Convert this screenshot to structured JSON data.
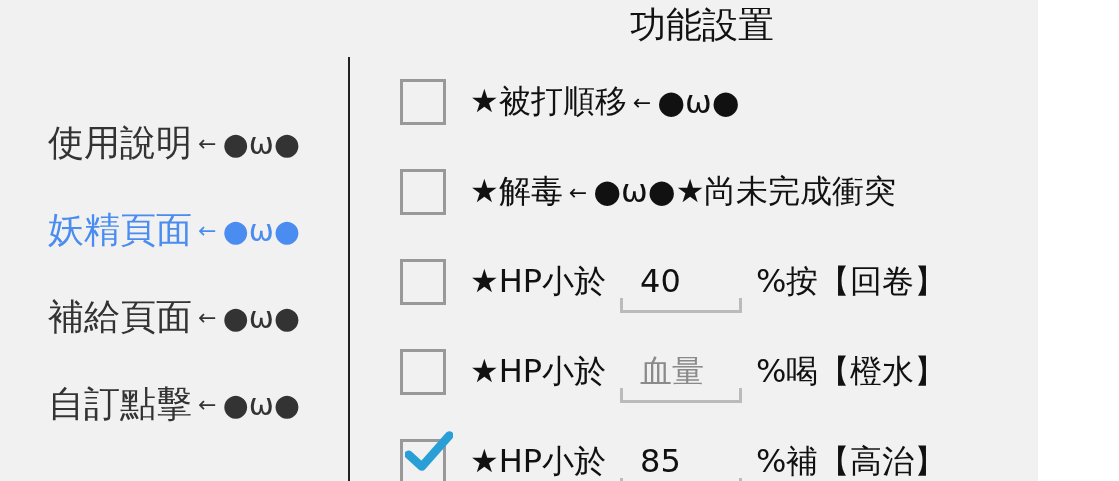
{
  "title": "功能設置",
  "menu": [
    {
      "label": "使用說明",
      "arrow": "←",
      "face": "●ω●",
      "selected": false
    },
    {
      "label": "妖精頁面",
      "arrow": "←",
      "face": "●ω●",
      "selected": true
    },
    {
      "label": "補給頁面",
      "arrow": "←",
      "face": "●ω●",
      "selected": false
    },
    {
      "label": "自訂點擊",
      "arrow": "←",
      "face": "●ω●",
      "selected": false
    }
  ],
  "options": [
    {
      "kind": "text",
      "checked": false,
      "label": "★被打順移",
      "arrow": "←",
      "tail": "●ω●"
    },
    {
      "kind": "text",
      "checked": false,
      "label": "★解毒",
      "arrow": "←",
      "tail": "●ω●★尚未完成衝突"
    },
    {
      "kind": "threshold",
      "checked": false,
      "label": "★HP小於",
      "value": "40",
      "suffix": "%按【回卷】"
    },
    {
      "kind": "threshold",
      "checked": false,
      "label": "★HP小於",
      "placeholder": "血量",
      "suffix": "%喝【橙水】"
    },
    {
      "kind": "threshold",
      "checked": true,
      "label": "★HP小於",
      "value": "85",
      "suffix": "%補【高治】"
    }
  ]
}
